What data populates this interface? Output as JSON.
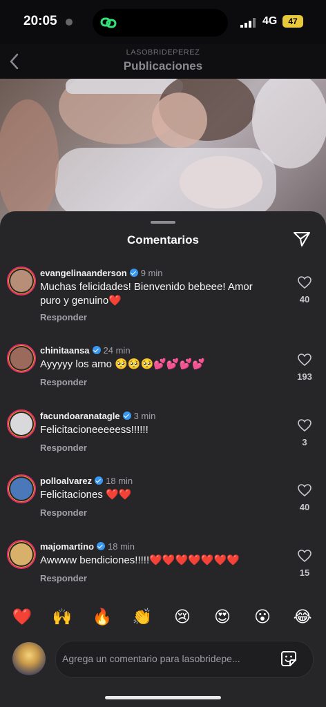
{
  "status_bar": {
    "time": "20:05",
    "network": "4G",
    "battery": "47"
  },
  "nav": {
    "username": "LASOBRIDEPEREZ",
    "title": "Publicaciones"
  },
  "sheet": {
    "title": "Comentarios"
  },
  "comments": [
    {
      "user": "evangelinaanderson",
      "time": "9 min",
      "text": "Muchas felicidades! Bienvenido bebeee! Amor puro y genuino❤️",
      "likes": "40"
    },
    {
      "user": "chinitaansa",
      "time": "24 min",
      "text": "Ayyyyy los amo 🥺🥺🥺💕💕💕💕",
      "likes": "193"
    },
    {
      "user": "facundoaranatagle",
      "time": "3 min",
      "text": "Felicitacioneeeeess!!!!!!",
      "likes": "3"
    },
    {
      "user": "polloalvarez",
      "time": "18 min",
      "text": "Felicitaciones ❤️❤️",
      "likes": "40"
    },
    {
      "user": "majomartino",
      "time": "18 min",
      "text": "Awwww bendiciones!!!!!❤️❤️❤️❤️❤️❤️❤️",
      "likes": "15"
    }
  ],
  "reply_label": "Responder",
  "emoji_bar": [
    "❤️",
    "🙌",
    "🔥",
    "👏",
    "😢",
    "😍",
    "😮",
    "😂"
  ],
  "composer": {
    "placeholder": "Agrega un comentario para lasobridepe..."
  },
  "colors": {
    "sheet": "#262629",
    "accent": "#3897f0",
    "heart": "#e0245e"
  }
}
